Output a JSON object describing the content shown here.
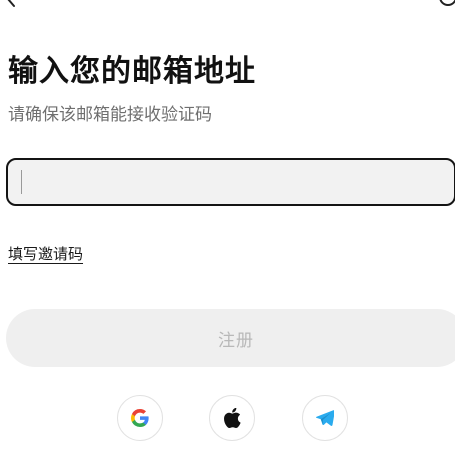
{
  "header": {
    "back_icon": "chevron-left-icon",
    "help_icon": "help-circle-icon"
  },
  "main": {
    "title": "输入您的邮箱地址",
    "subtitle": "请确保该邮箱能接收验证码",
    "email_input": {
      "value": "",
      "placeholder": ""
    },
    "invite_link": "填写邀请码",
    "register_button": "注册"
  },
  "social_login": {
    "google": "google-icon",
    "apple": "apple-icon",
    "telegram": "telegram-icon"
  },
  "colors": {
    "input_background": "#f2f2f2",
    "input_border": "#141414",
    "button_disabled_bg": "#efefef",
    "button_disabled_text": "#b8b8b8",
    "google_blue": "#4285F4",
    "google_red": "#EA4335",
    "google_yellow": "#FBBC05",
    "google_green": "#34A853",
    "telegram_blue": "#2AABEE"
  }
}
